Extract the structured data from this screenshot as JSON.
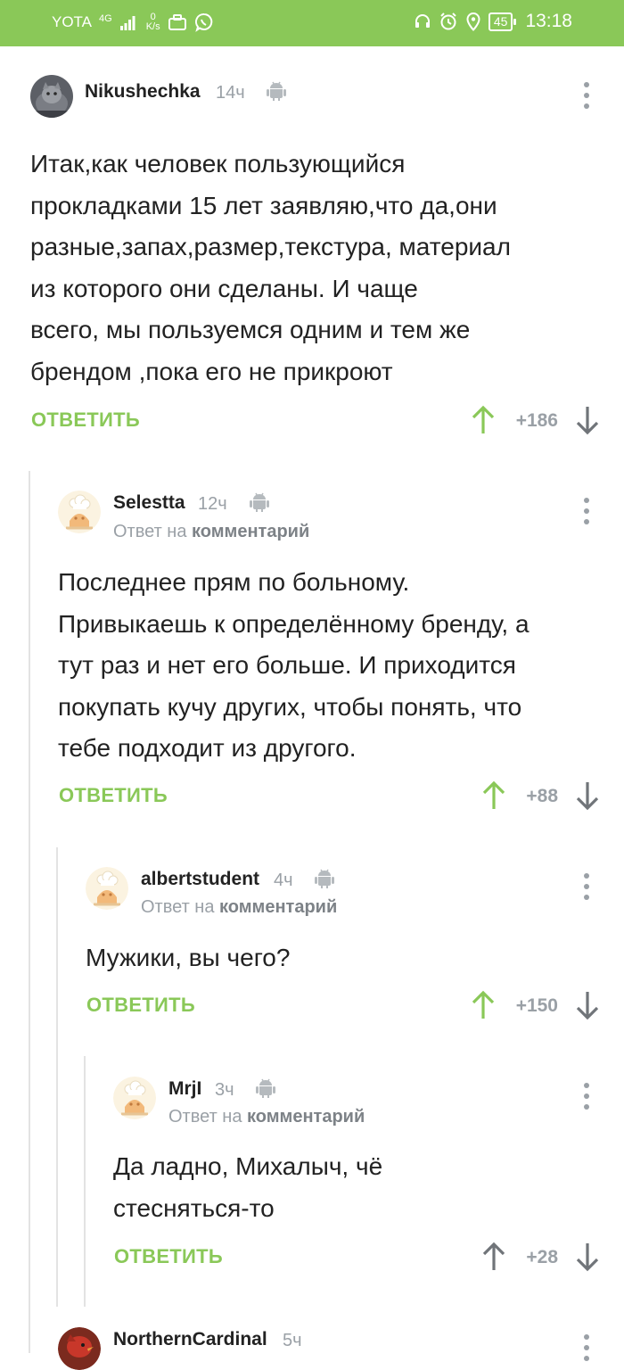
{
  "status_bar": {
    "carrier": "YOTA",
    "network": "4G",
    "speed_value": "0",
    "speed_unit": "K/s",
    "battery": "45",
    "time": "13:18"
  },
  "icons": {
    "android": "android-icon",
    "menu": "more-vertical-icon",
    "upvote": "arrow-up-icon",
    "downvote": "arrow-down-icon"
  },
  "colors": {
    "accent": "#8ac858",
    "muted": "#9aa0a6",
    "text": "#222222"
  },
  "comments": [
    {
      "username": "Nikushechka",
      "time": "14ч",
      "text_lines": [
        "Итак,как человек пользующийся",
        "прокладками 15 лет заявляю,что да,они",
        "разные,запах,размер,текстура, материал",
        "из которого они сделаны. И чаще",
        "всего, мы пользуемся одним и тем же",
        "брендом ,пока его не прикроют"
      ],
      "reply_label": "ОТВЕТИТЬ",
      "score": "+186",
      "voted_up": true
    },
    {
      "username": "Selestta",
      "time": "12ч",
      "reply_prefix": "Ответ на",
      "reply_target": "комментарий",
      "text_lines": [
        "Последнее прям по больному.",
        "Привыкаешь к определённому бренду, а",
        "тут раз и нет его больше. И приходится",
        "покупать кучу других, чтобы понять, что",
        "тебе подходит из другого."
      ],
      "reply_label": "ОТВЕТИТЬ",
      "score": "+88",
      "voted_up": true
    },
    {
      "username": "albertstudent",
      "time": "4ч",
      "reply_prefix": "Ответ на",
      "reply_target": "комментарий",
      "text_lines": [
        "Мужики, вы чего?"
      ],
      "reply_label": "ОТВЕТИТЬ",
      "score": "+150",
      "voted_up": true
    },
    {
      "username": "MrjI",
      "time": "3ч",
      "reply_prefix": "Ответ на",
      "reply_target": "комментарий",
      "text_lines": [
        "Да ладно, Михалыч, чё",
        "стесняться-то"
      ],
      "reply_label": "ОТВЕТИТЬ",
      "score": "+28",
      "voted_up": false
    },
    {
      "username": "NorthernCardinal",
      "time": "5ч"
    }
  ]
}
